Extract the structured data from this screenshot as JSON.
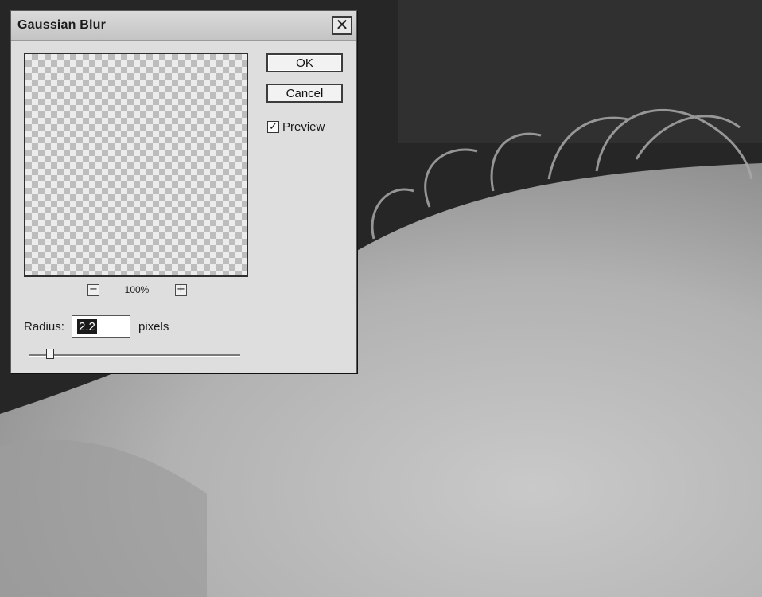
{
  "dialog": {
    "title": "Gaussian Blur",
    "close_label": "✕",
    "ok_label": "OK",
    "cancel_label": "Cancel",
    "preview_checkbox": {
      "label": "Preview",
      "checked": true,
      "check_glyph": "✓"
    },
    "zoom": {
      "minus_label": "−",
      "plus_label": "+",
      "level": "100%"
    },
    "radius": {
      "label": "Radius:",
      "value": "2.2",
      "units": "pixels"
    },
    "slider": {
      "fraction": 0.1
    }
  },
  "colors": {
    "dialog_bg": "#dedede",
    "titlebar_bg": "#cfcfcf",
    "background_photo": "#b5b5b5"
  }
}
